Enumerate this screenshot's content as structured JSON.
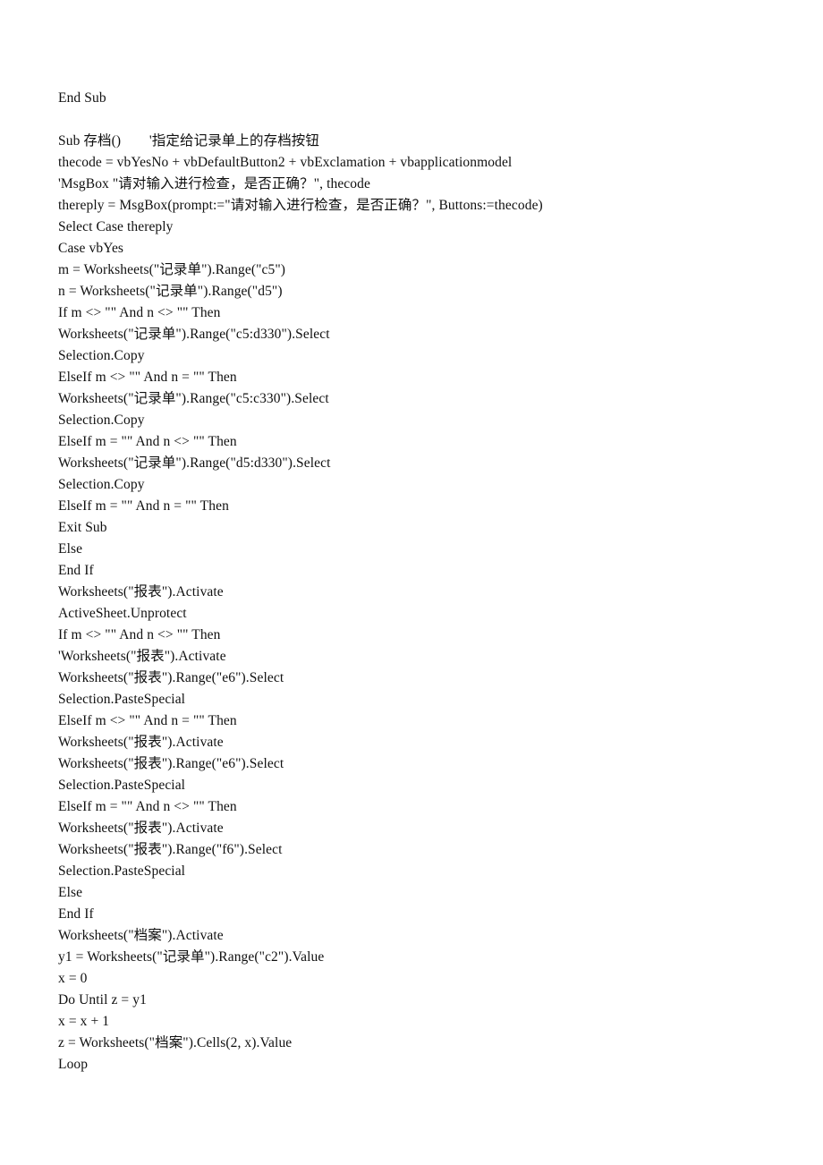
{
  "document": {
    "type": "code-listing",
    "language": "VBA",
    "background_color": "#ffffff",
    "text_color": "#101010",
    "lines": [
      "End Sub",
      "",
      "Sub 存档()        '指定给记录单上的存档按钮",
      "thecode = vbYesNo + vbDefaultButton2 + vbExclamation + vbapplicationmodel",
      "'MsgBox \"请对输入进行检查，是否正确？\", thecode",
      "thereply = MsgBox(prompt:=\"请对输入进行检查，是否正确？\", Buttons:=thecode)",
      "Select Case thereply",
      "Case vbYes",
      "m = Worksheets(\"记录单\").Range(\"c5\")",
      "n = Worksheets(\"记录单\").Range(\"d5\")",
      "If m <> \"\" And n <> \"\" Then",
      "Worksheets(\"记录单\").Range(\"c5:d330\").Select",
      "Selection.Copy",
      "ElseIf m <> \"\" And n = \"\" Then",
      "Worksheets(\"记录单\").Range(\"c5:c330\").Select",
      "Selection.Copy",
      "ElseIf m = \"\" And n <> \"\" Then",
      "Worksheets(\"记录单\").Range(\"d5:d330\").Select",
      "Selection.Copy",
      "ElseIf m = \"\" And n = \"\" Then",
      "Exit Sub",
      "Else",
      "End If",
      "Worksheets(\"报表\").Activate",
      "ActiveSheet.Unprotect",
      "If m <> \"\" And n <> \"\" Then",
      "'Worksheets(\"报表\").Activate",
      "Worksheets(\"报表\").Range(\"e6\").Select",
      "Selection.PasteSpecial",
      "ElseIf m <> \"\" And n = \"\" Then",
      "Worksheets(\"报表\").Activate",
      "Worksheets(\"报表\").Range(\"e6\").Select",
      "Selection.PasteSpecial",
      "ElseIf m = \"\" And n <> \"\" Then",
      "Worksheets(\"报表\").Activate",
      "Worksheets(\"报表\").Range(\"f6\").Select",
      "Selection.PasteSpecial",
      "Else",
      "End If",
      "Worksheets(\"档案\").Activate",
      "y1 = Worksheets(\"记录单\").Range(\"c2\").Value",
      "x = 0",
      "Do Until z = y1",
      "x = x + 1",
      "z = Worksheets(\"档案\").Cells(2, x).Value",
      "Loop"
    ]
  }
}
